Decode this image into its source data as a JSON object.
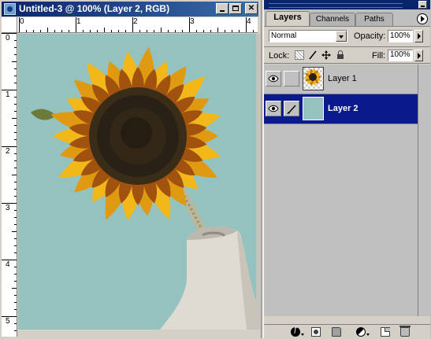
{
  "document": {
    "title": "Untitled-3 @ 100% (Layer 2, RGB)",
    "ruler_h_labels": [
      "0",
      "1",
      "2",
      "3",
      "4"
    ],
    "ruler_v_labels": [
      "0",
      "1",
      "2",
      "3",
      "4",
      "5"
    ],
    "canvas_color": "#94c2bf"
  },
  "palette": {
    "tabs": [
      {
        "label": "Layers",
        "active": true
      },
      {
        "label": "Channels",
        "active": false
      },
      {
        "label": "Paths",
        "active": false
      }
    ],
    "blend_mode": "Normal",
    "opacity_label": "Opacity:",
    "opacity_value": "100%",
    "lock_label": "Lock:",
    "fill_label": "Fill:",
    "fill_value": "100%",
    "layers": [
      {
        "name": "Layer 1",
        "visible": true,
        "selected": false
      },
      {
        "name": "Layer 2",
        "visible": true,
        "selected": true
      }
    ],
    "selection_color": "#0a1a8c",
    "bottom_icons": [
      "layer-style-icon",
      "layer-mask-icon",
      "layer-set-icon",
      "adjustment-layer-icon",
      "new-layer-icon",
      "trash-icon"
    ]
  }
}
